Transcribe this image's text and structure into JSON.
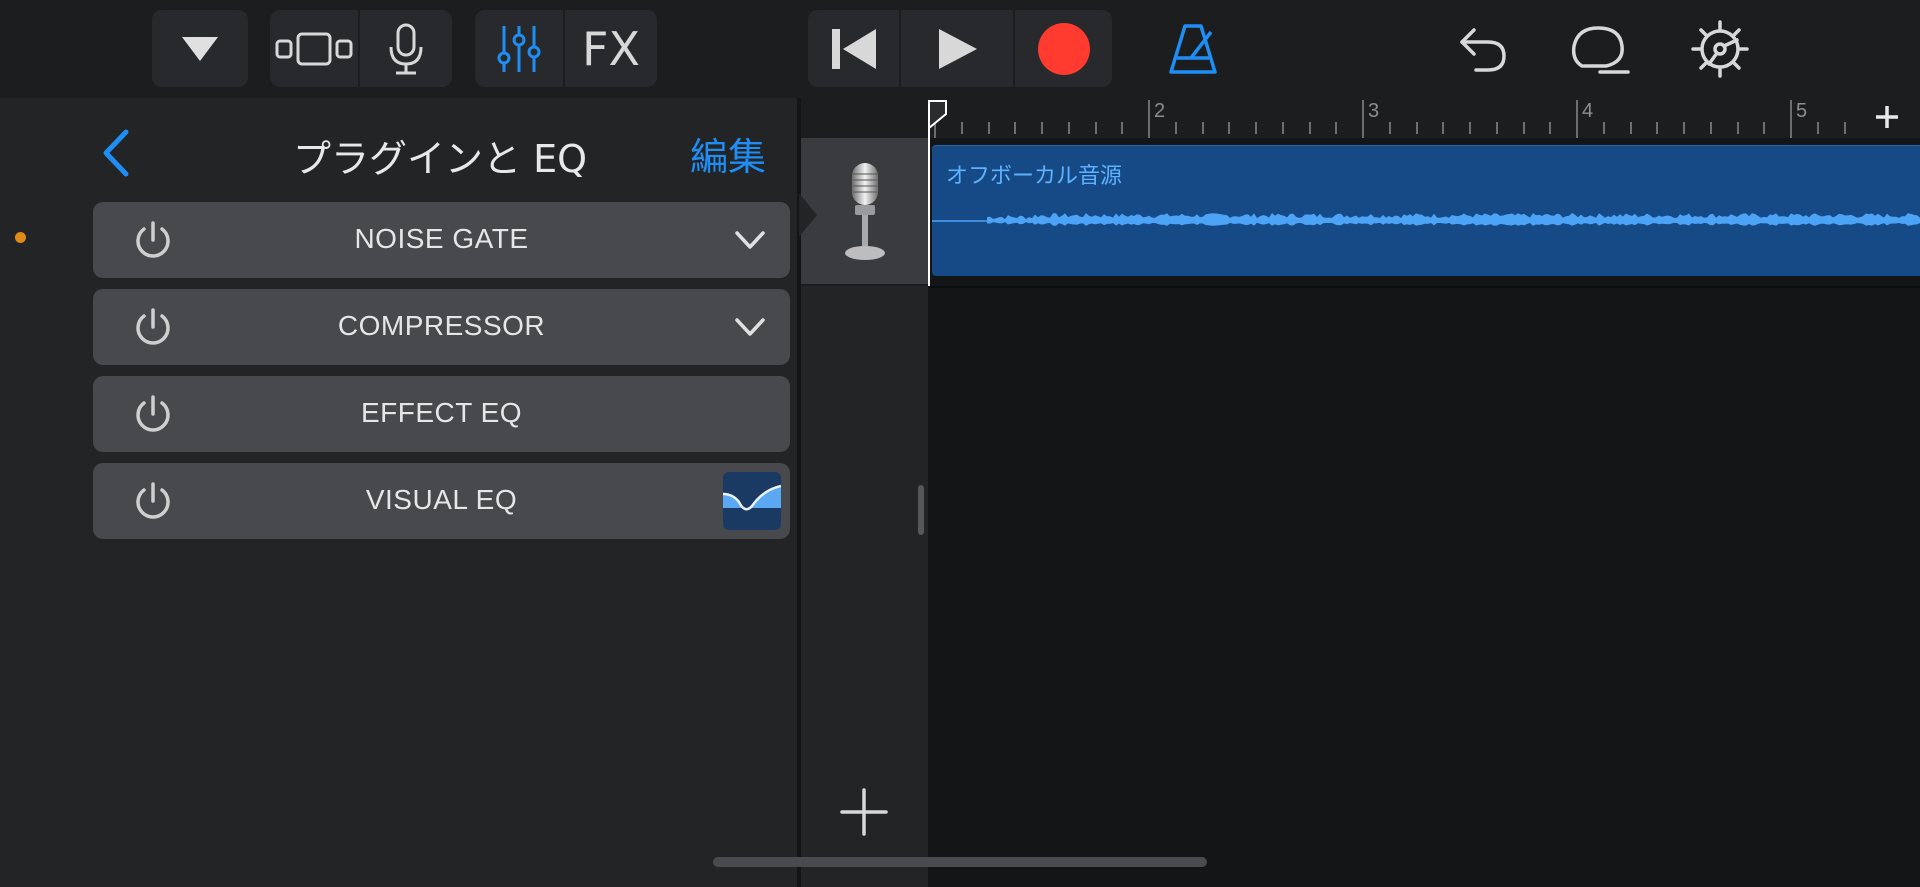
{
  "toolbar": {
    "browser_icon": "triangle-down-icon",
    "view_icon": "track-view-icon",
    "mic_icon": "microphone-icon",
    "mixer_icon": "sliders-icon",
    "fx_label": "FX",
    "rewind_icon": "go-to-start-icon",
    "play_icon": "play-icon",
    "record_icon": "record-icon",
    "metronome_icon": "metronome-icon",
    "undo_icon": "undo-icon",
    "loop_icon": "loop-icon",
    "settings_icon": "gear-icon",
    "colors": {
      "accent": "#1e8ef5",
      "record": "#ff3b30"
    }
  },
  "plugins_panel": {
    "back_icon": "chevron-left-icon",
    "title": "プラグインと EQ",
    "edit_label": "編集",
    "items": [
      {
        "name": "NOISE GATE",
        "expandable": true
      },
      {
        "name": "COMPRESSOR",
        "expandable": true
      },
      {
        "name": "EFFECT EQ",
        "expandable": false
      },
      {
        "name": "VISUAL EQ",
        "expandable": false,
        "thumbnail": "eq-curve-icon"
      }
    ]
  },
  "tracks": {
    "items": [
      {
        "icon": "microphone-icon"
      }
    ],
    "add_icon": "plus-icon"
  },
  "timeline": {
    "ruler_numbers": [
      "2",
      "3",
      "4",
      "5"
    ],
    "add_icon": "plus-icon",
    "region": {
      "name": "オフボーカル音源",
      "color": "#164a86"
    }
  }
}
